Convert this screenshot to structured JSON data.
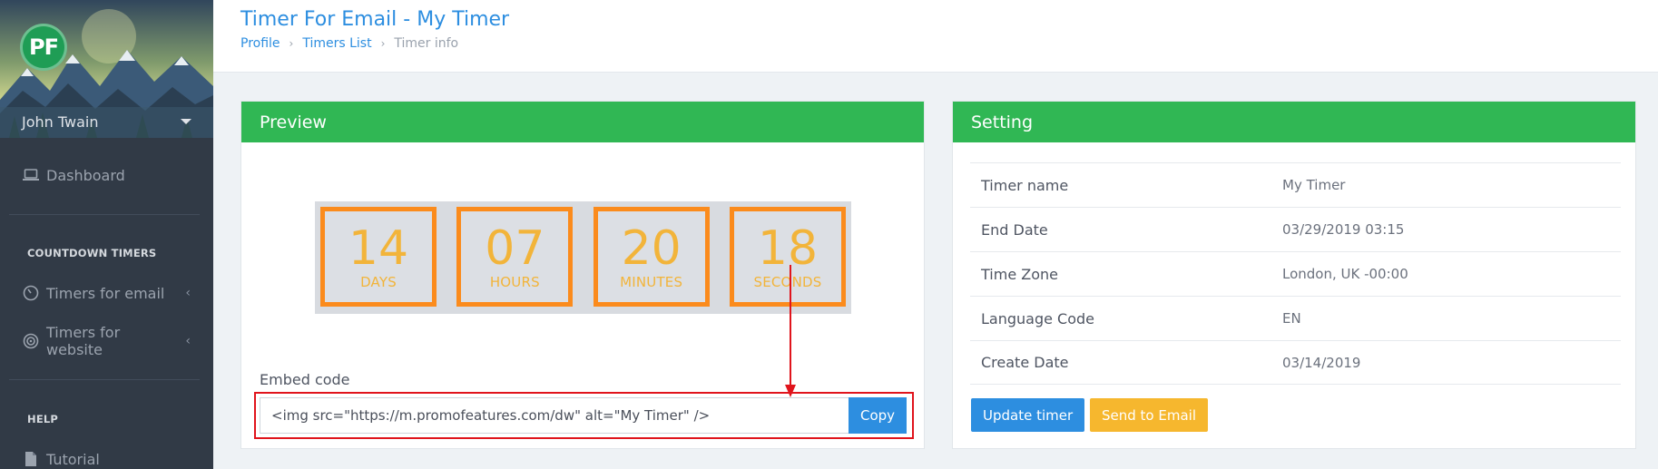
{
  "sidebar": {
    "avatar_initials": "PF",
    "user_name": "John Twain",
    "items": [
      {
        "label": "Dashboard",
        "icon": "laptop-icon"
      },
      {
        "label": "Timers for email",
        "icon": "clock-icon"
      },
      {
        "label": "Timers for website",
        "icon": "target-icon"
      },
      {
        "label": "Tutorial",
        "icon": "document-icon"
      }
    ],
    "sections": {
      "countdown": "COUNTDOWN TIMERS",
      "help": "HELP"
    }
  },
  "header": {
    "title": "Timer For Email - My Timer",
    "breadcrumb": [
      "Profile",
      "Timers List",
      "Timer info"
    ]
  },
  "preview": {
    "title": "Preview",
    "timer": [
      {
        "value": "14",
        "label": "DAYS"
      },
      {
        "value": "07",
        "label": "HOURS"
      },
      {
        "value": "20",
        "label": "MINUTES"
      },
      {
        "value": "18",
        "label": "SECONDS"
      }
    ],
    "embed_label": "Embed code",
    "embed_value": "<img src=\"https://m.promofeatures.com/dw\" alt=\"My Timer\" />",
    "copy_label": "Copy"
  },
  "setting": {
    "title": "Setting",
    "rows": [
      {
        "key": "Timer name",
        "value": "My Timer"
      },
      {
        "key": "End Date",
        "value": "03/29/2019 03:15"
      },
      {
        "key": "Time Zone",
        "value": "London, UK -00:00"
      },
      {
        "key": "Language Code",
        "value": "EN"
      },
      {
        "key": "Create Date",
        "value": "03/14/2019"
      }
    ],
    "update_label": "Update timer",
    "send_label": "Send to Email"
  },
  "colors": {
    "brand_green": "#30b754",
    "primary_blue": "#2d8ee0",
    "timer_orange": "#fb8b1c",
    "warning_yellow": "#f6b72e",
    "sidebar_dark": "#313a46",
    "annotation_red": "#e0141c"
  }
}
